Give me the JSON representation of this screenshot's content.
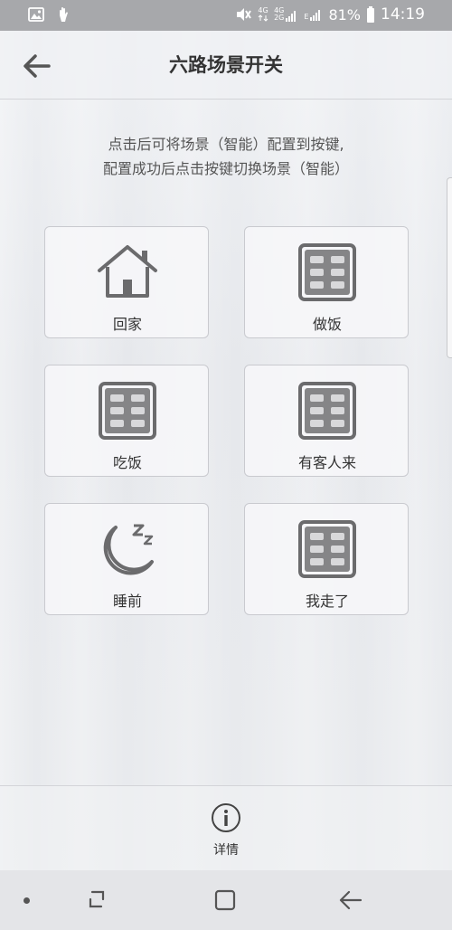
{
  "status_bar": {
    "net1": "4G",
    "net2": "4G",
    "net3": "E",
    "battery_percent": "81%",
    "time": "14:19"
  },
  "header": {
    "title": "六路场景开关"
  },
  "instructions": {
    "line1": "点击后可将场景（智能）配置到按键,",
    "line2": "配置成功后点击按键切换场景（智能）"
  },
  "scenes": [
    {
      "label": "回家",
      "icon": "home-icon"
    },
    {
      "label": "做饭",
      "icon": "keypad-icon"
    },
    {
      "label": "吃饭",
      "icon": "keypad-icon"
    },
    {
      "label": "有客人来",
      "icon": "keypad-icon"
    },
    {
      "label": "睡前",
      "icon": "moon-sleep-icon"
    },
    {
      "label": "我走了",
      "icon": "keypad-icon"
    }
  ],
  "footer": {
    "details_label": "详情",
    "details_icon": "info-icon"
  },
  "colors": {
    "status_bar_bg": "#a7a8ab",
    "icon_gray": "#6b6b6d",
    "text_dark": "#333333"
  }
}
